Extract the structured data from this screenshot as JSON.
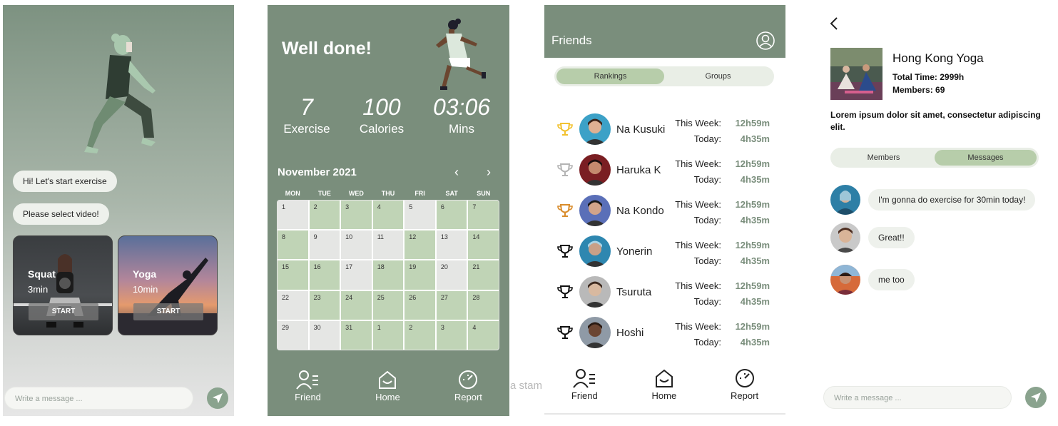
{
  "chat_screen": {
    "bubbles": [
      "Hi! Let's start exercise",
      "Please select video!"
    ],
    "videos": [
      {
        "title": "Squat",
        "duration": "3min",
        "button": "START"
      },
      {
        "title": "Yoga",
        "duration": "10min",
        "button": "START"
      }
    ],
    "input_placeholder": "Write a message ..."
  },
  "stats_screen": {
    "headline": "Well done!",
    "stats": [
      {
        "value": "7",
        "label": "Exercise"
      },
      {
        "value": "100",
        "label": "Calories"
      },
      {
        "value": "03:06",
        "label": "Mins"
      }
    ],
    "month": "November 2021",
    "weekdays": [
      "MON",
      "TUE",
      "WED",
      "THU",
      "FRI",
      "SAT",
      "SUN"
    ],
    "days": [
      {
        "d": "1",
        "done": false
      },
      {
        "d": "2",
        "done": true
      },
      {
        "d": "3",
        "done": true
      },
      {
        "d": "4",
        "done": true
      },
      {
        "d": "5",
        "done": false
      },
      {
        "d": "6",
        "done": true
      },
      {
        "d": "7",
        "done": true
      },
      {
        "d": "8",
        "done": true
      },
      {
        "d": "9",
        "done": false
      },
      {
        "d": "10",
        "done": false
      },
      {
        "d": "11",
        "done": false
      },
      {
        "d": "12",
        "done": true
      },
      {
        "d": "13",
        "done": false
      },
      {
        "d": "14",
        "done": true
      },
      {
        "d": "15",
        "done": true
      },
      {
        "d": "16",
        "done": true
      },
      {
        "d": "17",
        "done": false
      },
      {
        "d": "18",
        "done": true
      },
      {
        "d": "19",
        "done": true
      },
      {
        "d": "20",
        "done": false
      },
      {
        "d": "21",
        "done": true
      },
      {
        "d": "22",
        "done": false
      },
      {
        "d": "23",
        "done": true
      },
      {
        "d": "24",
        "done": true
      },
      {
        "d": "25",
        "done": true
      },
      {
        "d": "26",
        "done": true
      },
      {
        "d": "27",
        "done": true
      },
      {
        "d": "28",
        "done": true
      },
      {
        "d": "29",
        "done": false
      },
      {
        "d": "30",
        "done": false
      },
      {
        "d": "31",
        "done": true
      },
      {
        "d": "1",
        "done": true
      },
      {
        "d": "2",
        "done": true
      },
      {
        "d": "3",
        "done": true
      },
      {
        "d": "4",
        "done": true
      }
    ],
    "tabs": [
      "Friend",
      "Home",
      "Report"
    ]
  },
  "friends_screen": {
    "title": "Friends",
    "segments": [
      "Rankings",
      "Groups"
    ],
    "this_week_label": "This Week:",
    "today_label": "Today:",
    "friends": [
      {
        "name": "Na Kusuki",
        "week": "12h59m",
        "today": "4h35m",
        "trophy_color": "#f2c230"
      },
      {
        "name": "Haruka K",
        "week": "12h59m",
        "today": "4h35m",
        "trophy_color": "#b4b4b4"
      },
      {
        "name": "Na Kondo",
        "week": "12h59m",
        "today": "4h35m",
        "trophy_color": "#d98c2b"
      },
      {
        "name": "Yonerin",
        "week": "12h59m",
        "today": "4h35m",
        "trophy_color": "#111111"
      },
      {
        "name": "Tsuruta",
        "week": "12h59m",
        "today": "4h35m",
        "trophy_color": "#111111"
      },
      {
        "name": "Hoshi",
        "week": "12h59m",
        "today": "4h35m",
        "trophy_color": "#111111"
      }
    ],
    "tabs": [
      "Friend",
      "Home",
      "Report"
    ]
  },
  "group_screen": {
    "name": "Hong Kong Yoga",
    "total_time": "Total Time: 2999h",
    "members": "Members: 69",
    "description": "Lorem ipsum dolor sit amet, consectetur adipiscing elit.",
    "segments": [
      "Members",
      "Messages"
    ],
    "messages": [
      "I'm gonna do exercise for 30min today!",
      "Great!!",
      "me too"
    ],
    "input_placeholder": "Write a message ..."
  },
  "overlay_fragment": "a stam",
  "colors": {
    "accent": "#7a8e7c",
    "calendar_done": "#c0d4b6",
    "segment_active": "#b7cdaa"
  }
}
